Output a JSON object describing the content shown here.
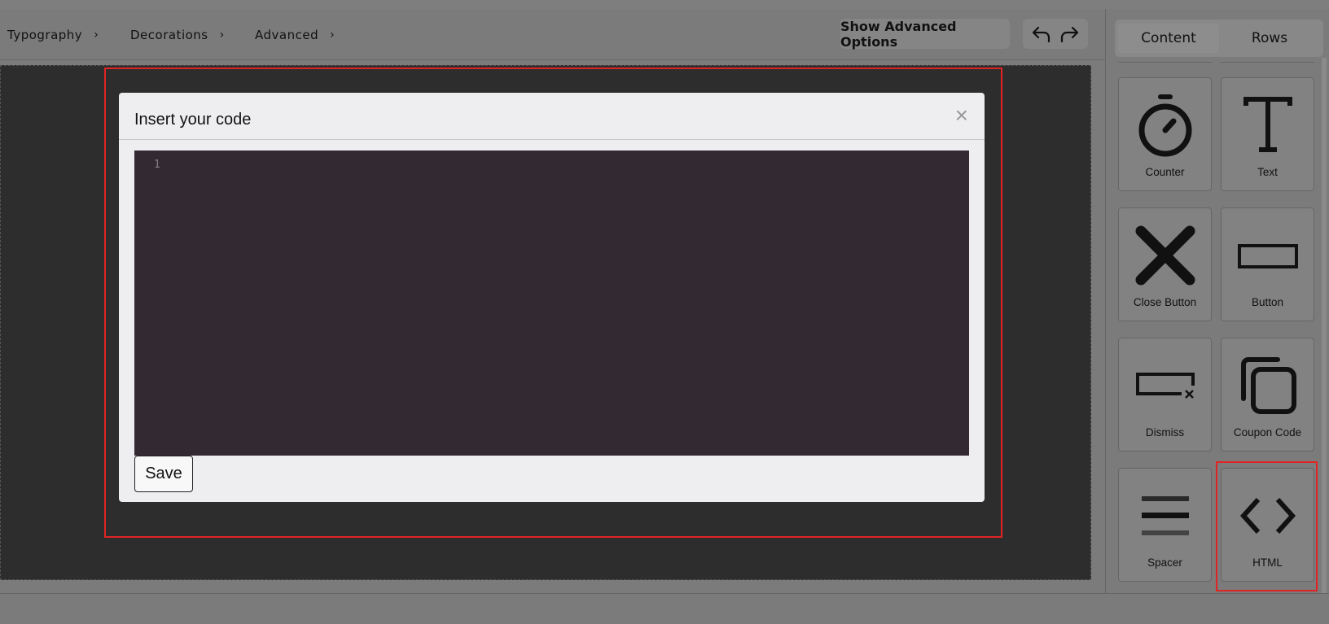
{
  "breadcrumbs": [
    {
      "label": "Typography",
      "chevron": "›"
    },
    {
      "label": "Decorations",
      "chevron": "›"
    },
    {
      "label": "Advanced",
      "chevron": "›"
    }
  ],
  "toolbar": {
    "advanced_label": "Show Advanced Options"
  },
  "modal": {
    "title": "Insert your code",
    "close": "×",
    "line_number": "1",
    "save_label": "Save"
  },
  "panel": {
    "tabs": [
      {
        "label": "Content",
        "active": true
      },
      {
        "label": "Rows",
        "active": false
      }
    ],
    "tiles": [
      {
        "label": "Counter",
        "icon": "stopwatch-icon"
      },
      {
        "label": "Text",
        "icon": "text-icon"
      },
      {
        "label": "Close Button",
        "icon": "close-icon"
      },
      {
        "label": "Button",
        "icon": "button-icon"
      },
      {
        "label": "Dismiss",
        "icon": "dismiss-icon"
      },
      {
        "label": "Coupon Code",
        "icon": "copy-icon"
      },
      {
        "label": "Spacer",
        "icon": "spacer-icon"
      },
      {
        "label": "HTML",
        "icon": "code-icon"
      }
    ]
  },
  "colors": {
    "selection": "#e02424",
    "editor_bg": "#332932",
    "canvas_bg": "#2d2d2d"
  }
}
